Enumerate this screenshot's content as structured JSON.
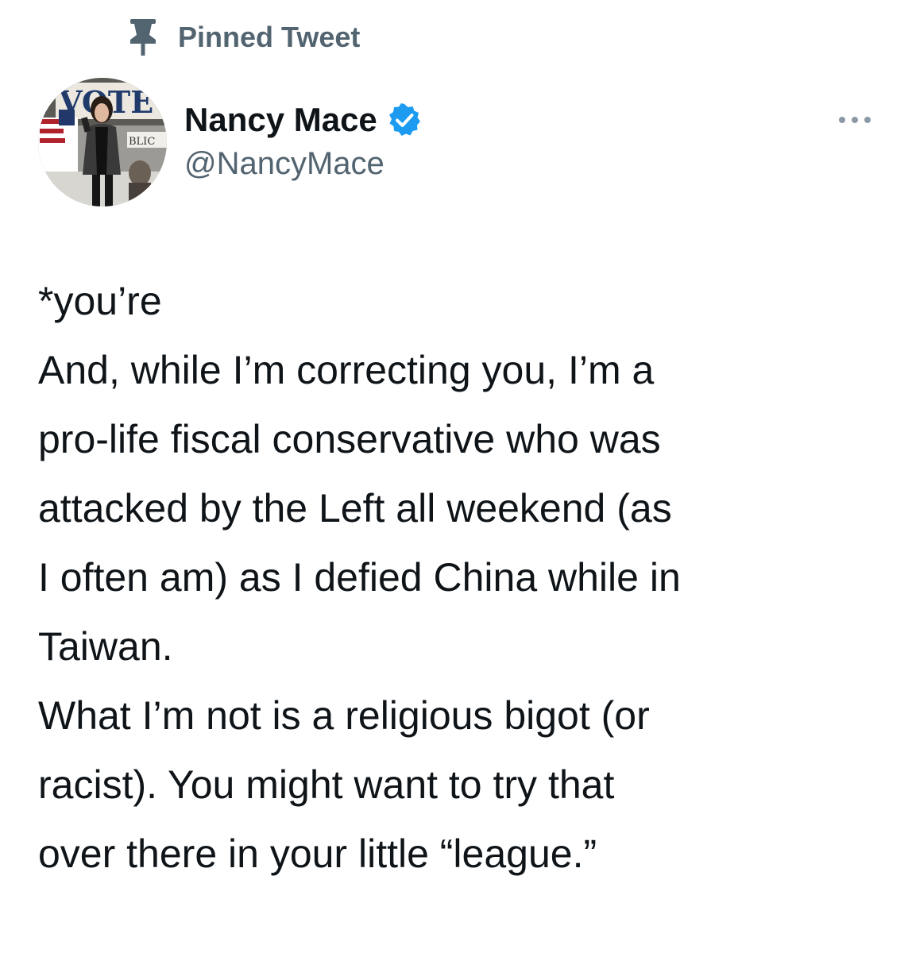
{
  "pinned": {
    "label": "Pinned Tweet",
    "icon": "pin-icon"
  },
  "author": {
    "display_name": "Nancy Mace",
    "handle": "@NancyMace",
    "verified": true,
    "verified_color": "#1d9bf0",
    "avatar_banner_text": "VOTE",
    "avatar_sign_text": "BLIC"
  },
  "more_icon": "more-options-icon",
  "tweet": {
    "paragraphs": [
      "*you’re",
      "And, while I’m correcting you, I’m a\npro-life fiscal conservative who was\nattacked by the Left all weekend (as\nI often am) as I defied China while in\nTaiwan.",
      "What I’m not is a religious bigot (or\nracist). You might want to try that\nover there in your little “league.”"
    ]
  },
  "colors": {
    "text_primary": "#0f1419",
    "text_secondary": "#536471",
    "background": "#ffffff"
  }
}
